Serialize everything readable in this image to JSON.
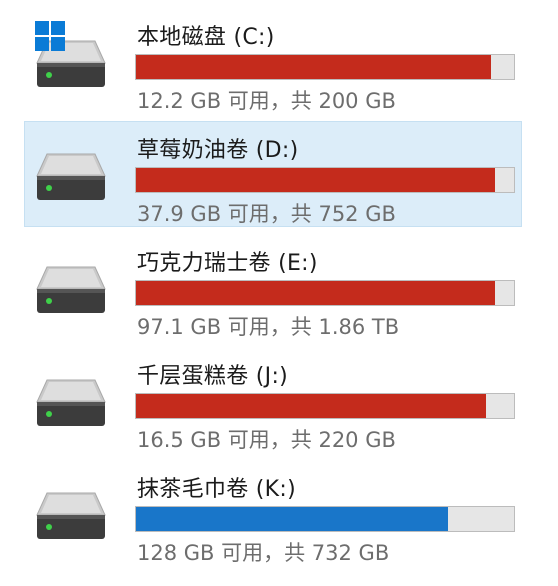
{
  "drives": [
    {
      "name": "本地磁盘 (C:)",
      "space": "12.2 GB 可用，共 200 GB",
      "used_fraction": 0.939,
      "status": "critical",
      "selected": false,
      "icon": "hard-drive-icon",
      "system": true
    },
    {
      "name": "草莓奶油卷 (D:)",
      "space": "37.9 GB 可用，共 752 GB",
      "used_fraction": 0.95,
      "status": "critical",
      "selected": true,
      "icon": "hard-drive-icon",
      "system": false
    },
    {
      "name": "巧克力瑞士卷 (E:)",
      "space": "97.1 GB 可用，共 1.86 TB",
      "used_fraction": 0.949,
      "status": "critical",
      "selected": false,
      "icon": "hard-drive-icon",
      "system": false
    },
    {
      "name": "千层蛋糕卷 (J:)",
      "space": "16.5 GB 可用，共 220 GB",
      "used_fraction": 0.925,
      "status": "critical",
      "selected": false,
      "icon": "hard-drive-icon",
      "system": false
    },
    {
      "name": "抹茶毛巾卷 (K:)",
      "space": "128 GB 可用，共 732 GB",
      "used_fraction": 0.825,
      "status": "normal",
      "selected": false,
      "icon": "hard-drive-icon",
      "system": false
    }
  ],
  "colors": {
    "critical_fill": "#c42b1c",
    "normal_fill": "#1976c9",
    "bar_background": "#e6e6e6",
    "selection_background": "#dcedf9",
    "windows_logo": "#0a7bd6"
  }
}
